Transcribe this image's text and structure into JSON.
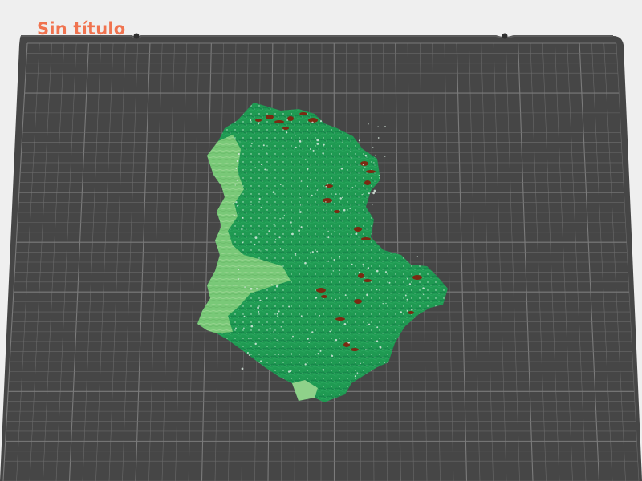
{
  "app": {
    "title": "Sin título"
  },
  "colors": {
    "background": "#efefef",
    "bed": "#464646",
    "bed_edge": "#3b3b3b",
    "grid": "#6a6a6a",
    "grid_strong": "#7b7b7b",
    "title": "#f0734f",
    "model_primary": "#1f9a52",
    "model_light": "#7ecb7a",
    "model_peaks": "#7a2a12",
    "model_snow": "#d9eadf"
  },
  "scene": {
    "object": "terrain-model",
    "view": "build-plate"
  }
}
